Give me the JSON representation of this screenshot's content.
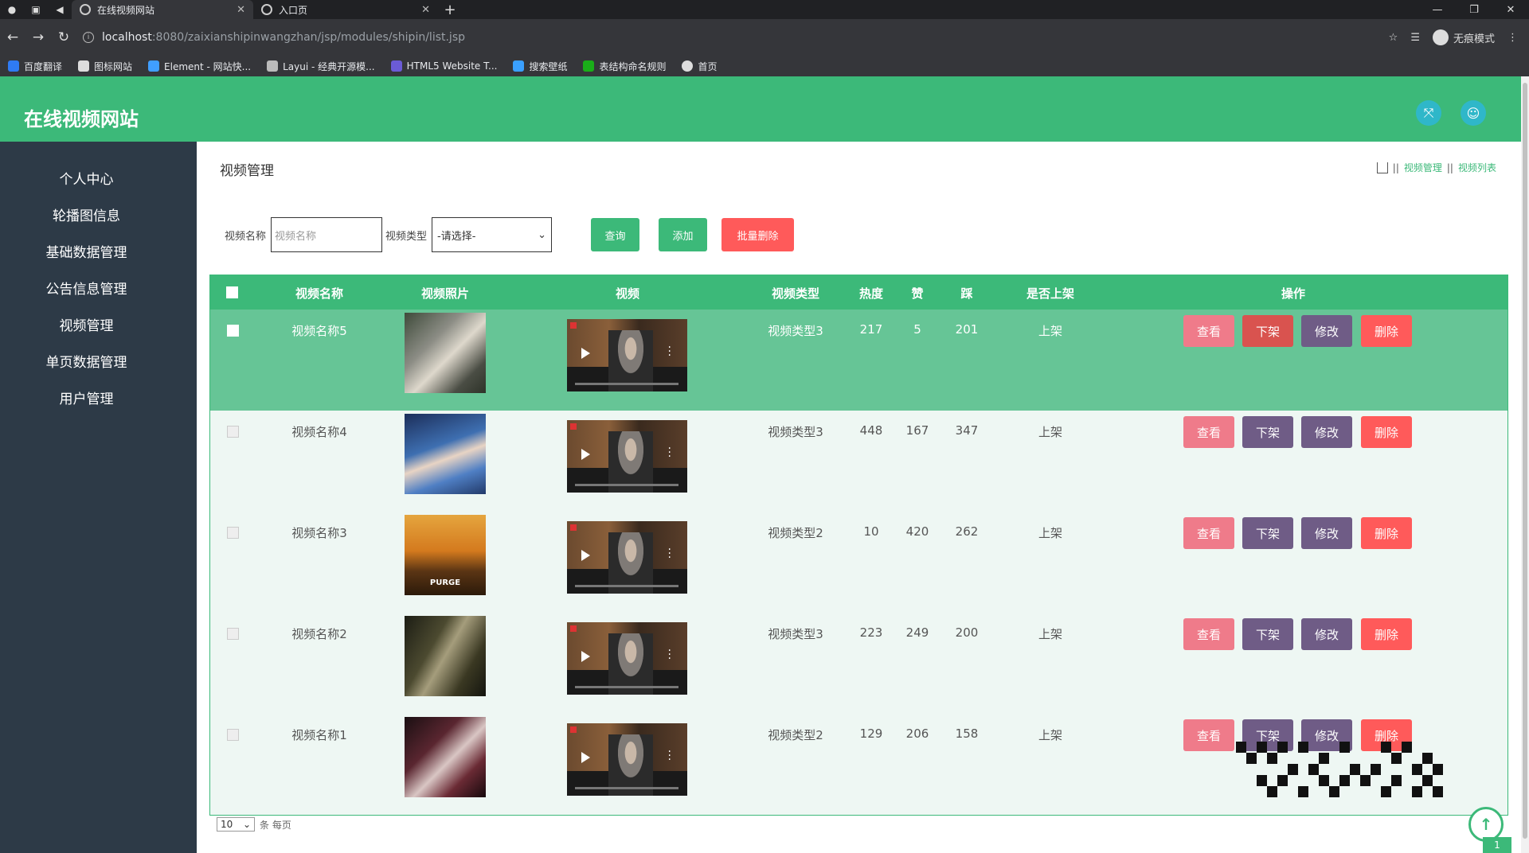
{
  "browser": {
    "tabs": [
      {
        "title": "在线视频网站",
        "active": true
      },
      {
        "title": "入口页",
        "active": false
      }
    ],
    "url_host": "localhost",
    "url_path": ":8080/zaixianshipinwangzhan/jsp/modules/shipin/list.jsp",
    "incognito_label": "无痕模式",
    "bookmarks": [
      "百度翻译",
      "图标网站",
      "Element - 网站快...",
      "Layui - 经典开源模...",
      "HTML5 Website T...",
      "搜索壁纸",
      "表结构命名规则",
      "首页"
    ]
  },
  "app": {
    "title": "在线视频网站",
    "sidebar": [
      "个人中心",
      "轮播图信息",
      "基础数据管理",
      "公告信息管理",
      "视频管理",
      "单页数据管理",
      "用户管理"
    ]
  },
  "page": {
    "title": "视频管理",
    "breadcrumb": [
      "视频管理",
      "视频列表"
    ]
  },
  "search": {
    "name_label": "视频名称",
    "name_placeholder": "视频名称",
    "type_label": "视频类型",
    "type_selected": "-请选择-",
    "search_button": "查询",
    "add_button": "添加",
    "batch_delete_button": "批量删除"
  },
  "table": {
    "headers": [
      "视频名称",
      "视频照片",
      "视频",
      "视频类型",
      "热度",
      "赞",
      "踩",
      "是否上架",
      "操作"
    ],
    "rows": [
      {
        "name": "视频名称5",
        "type": "视频类型3",
        "heat": "217",
        "likes": "5",
        "dislikes": "201",
        "status": "上架"
      },
      {
        "name": "视频名称4",
        "type": "视频类型3",
        "heat": "448",
        "likes": "167",
        "dislikes": "347",
        "status": "上架"
      },
      {
        "name": "视频名称3",
        "type": "视频类型2",
        "heat": "10",
        "likes": "420",
        "dislikes": "262",
        "status": "上架"
      },
      {
        "name": "视频名称2",
        "type": "视频类型3",
        "heat": "223",
        "likes": "249",
        "dislikes": "200",
        "status": "上架"
      },
      {
        "name": "视频名称1",
        "type": "视频类型2",
        "heat": "129",
        "likes": "206",
        "dislikes": "158",
        "status": "上架"
      }
    ],
    "actions": {
      "view": "查看",
      "off_shelf": "下架",
      "edit": "修改",
      "delete": "删除"
    },
    "poster_caption_row3": "PURGE"
  },
  "pagination": {
    "page_size": "10",
    "page_size_suffix": "条 每页",
    "current_page": "1"
  },
  "colors": {
    "primary": "#3cb979",
    "sidebar": "#2d3a47",
    "danger": "#ff5a5a",
    "view": "#ef7b8a",
    "purple": "#6f5c86"
  }
}
